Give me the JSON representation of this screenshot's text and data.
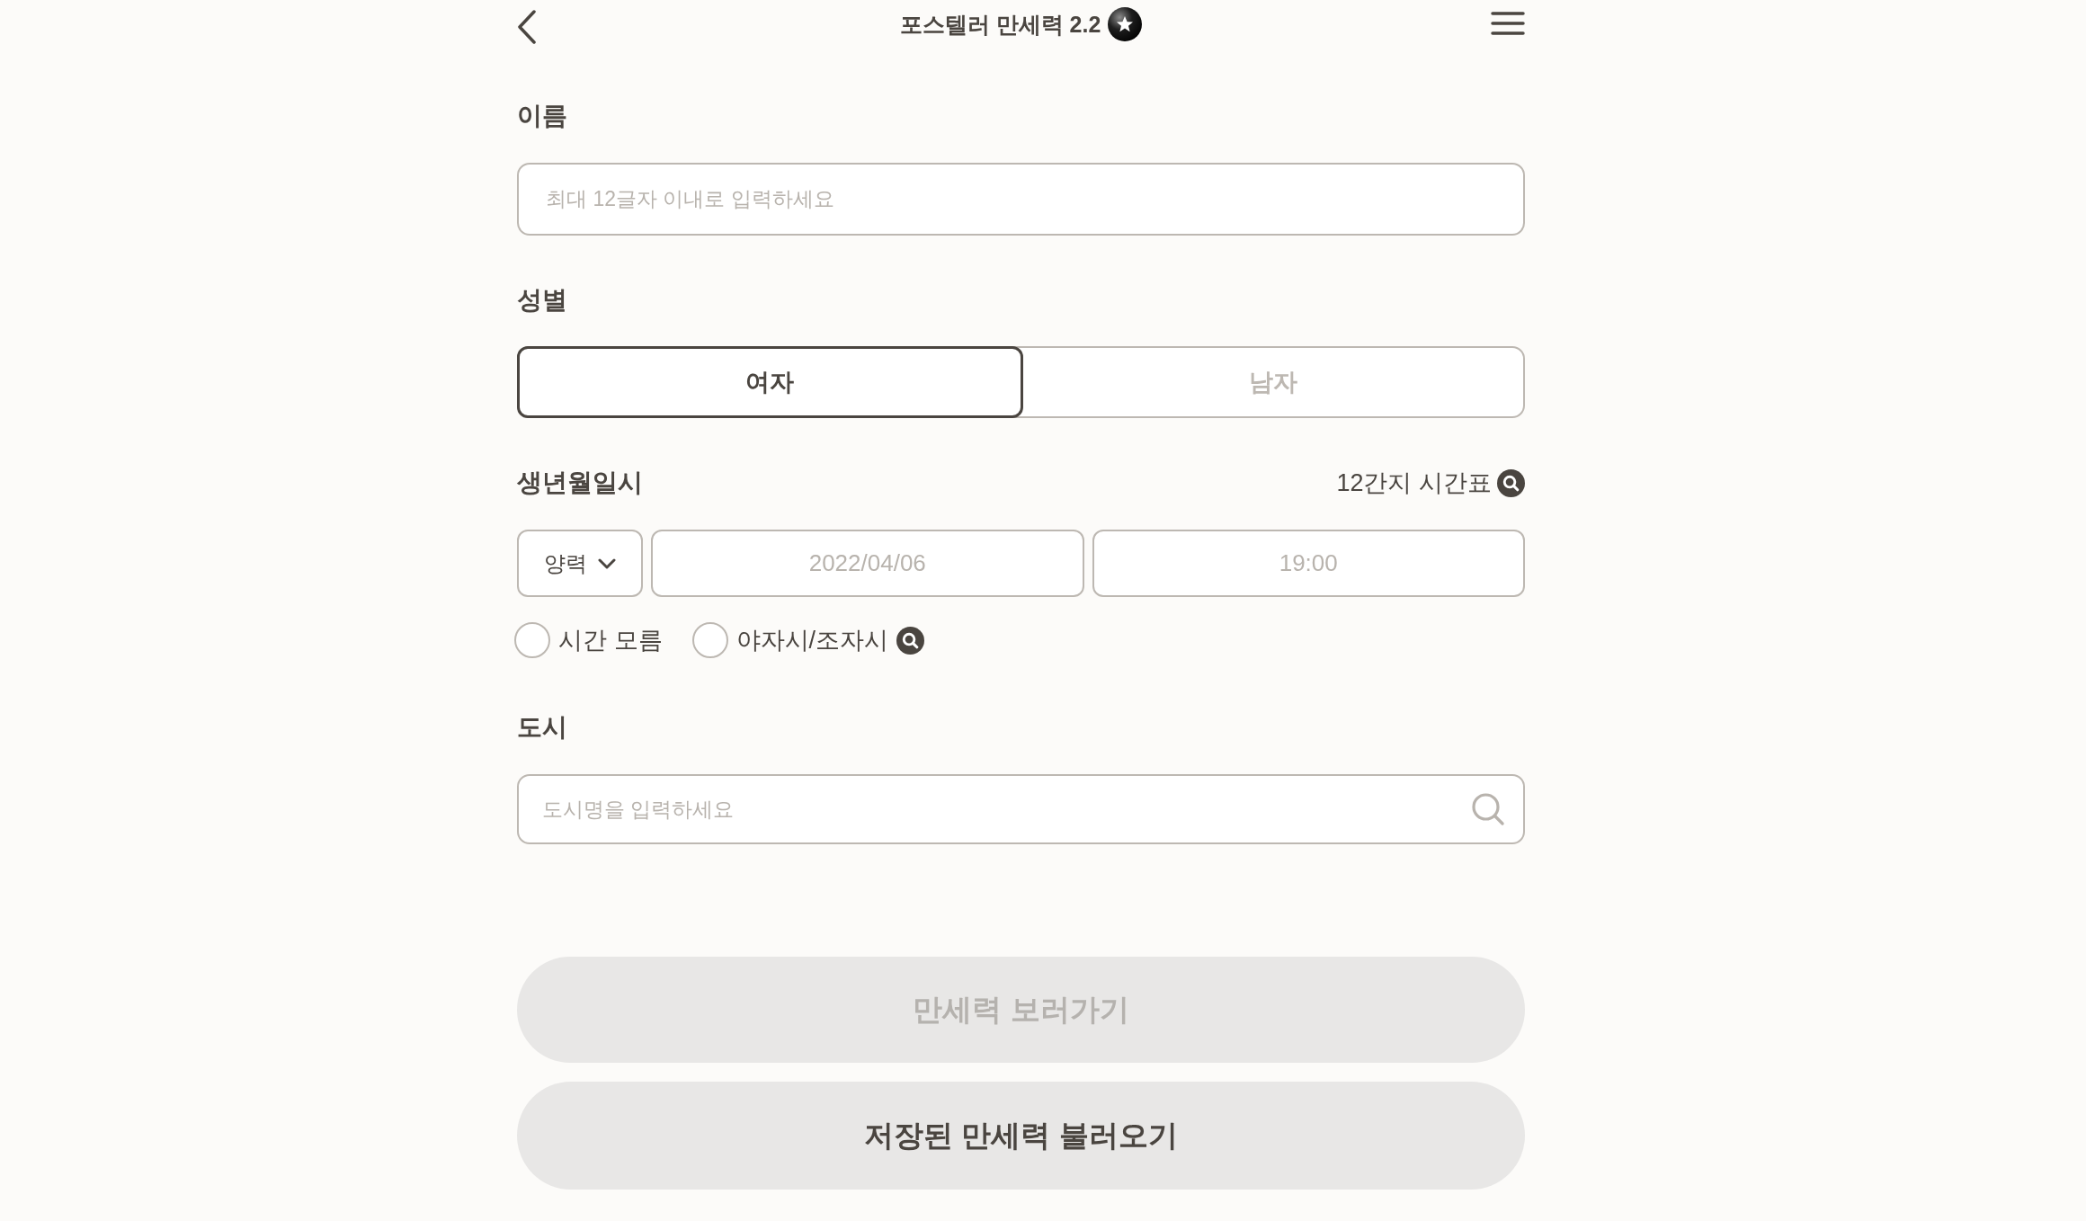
{
  "header": {
    "title": "포스텔러 만세력 2.2"
  },
  "name": {
    "label": "이름",
    "placeholder": "최대 12글자 이내로 입력하세요"
  },
  "gender": {
    "label": "성별",
    "options": [
      {
        "label": "여자",
        "selected": true
      },
      {
        "label": "남자",
        "selected": false
      }
    ]
  },
  "birth": {
    "label": "생년월일시",
    "timetable_link": "12간지 시간표",
    "calendar": {
      "value": "양력"
    },
    "date": {
      "placeholder": "2022/04/06"
    },
    "time": {
      "placeholder": "19:00"
    },
    "options": [
      {
        "kind": "plain",
        "label": "시간 모름",
        "checked": false
      },
      {
        "kind": "info",
        "label": "야자시/조자시",
        "checked": false
      }
    ]
  },
  "city": {
    "label": "도시",
    "placeholder": "도시명을 입력하세요"
  },
  "buttons": [
    {
      "label": "만세력 보러가기",
      "disabled": true
    },
    {
      "label": "저장된 만세력 불러오기",
      "disabled": false
    }
  ]
}
